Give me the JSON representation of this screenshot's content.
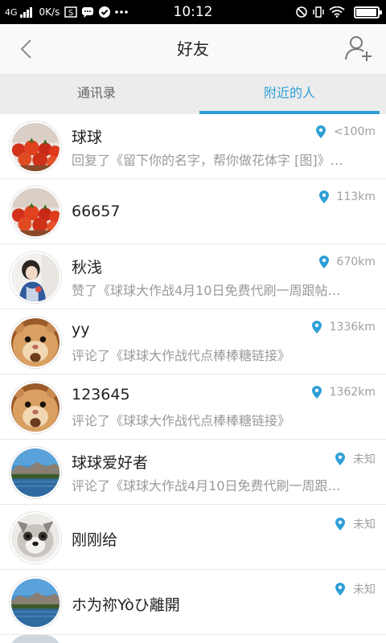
{
  "status_bar": {
    "network": "4G",
    "speed": "0K/s",
    "time": "10:12",
    "battery_level": 0.9
  },
  "header": {
    "title": "好友",
    "back_icon": "chevron-left-icon",
    "add_icon": "add-user-icon"
  },
  "tabs": [
    {
      "label": "通讯录",
      "active": false
    },
    {
      "label": "附近的人",
      "active": true
    }
  ],
  "accent_color": "#2e9fd6",
  "people": [
    {
      "name": "球球",
      "distance": "<100m",
      "activity": "回复了《留下你的名字，帮你做花体字 [图]》…",
      "avatar": "tomatoes"
    },
    {
      "name": "66657",
      "distance": "113km",
      "activity": "",
      "avatar": "tomatoes"
    },
    {
      "name": "秋浅",
      "distance": "670km",
      "activity": "赞了《球球大作战4月10日免费代刷一周跟帖…",
      "avatar": "girl"
    },
    {
      "name": "yy",
      "distance": "1336km",
      "activity": "评论了《球球大作战代点棒棒糖链接》",
      "avatar": "hamster"
    },
    {
      "name": "123645",
      "distance": "1362km",
      "activity": "评论了《球球大作战代点棒棒糖链接》",
      "avatar": "hamster"
    },
    {
      "name": "球球爱好者",
      "distance": "未知",
      "activity": "评论了《球球大作战4月10日免费代刷一周跟…",
      "avatar": "lake"
    },
    {
      "name": "刚刚给",
      "distance": "未知",
      "activity": "",
      "avatar": "dog"
    },
    {
      "name": "ホ为祢Yòひ離開",
      "distance": "未知",
      "activity": "",
      "avatar": "lake"
    }
  ]
}
